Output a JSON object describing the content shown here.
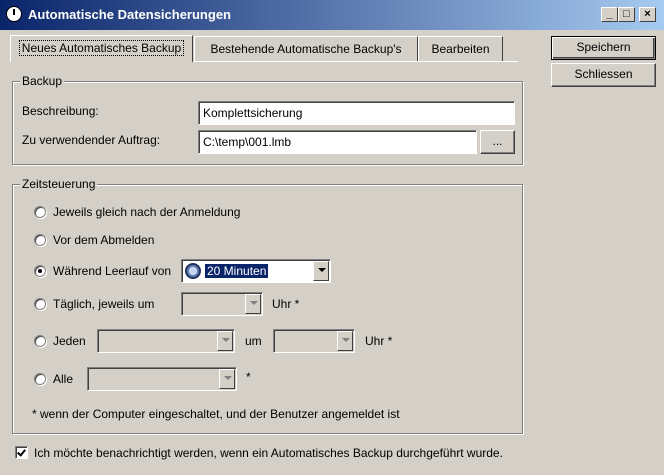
{
  "window": {
    "title": "Automatische Datensicherungen",
    "minimize": "_",
    "maximize": "□",
    "close": "×"
  },
  "tabs": [
    {
      "label": "Neues Automatisches Backup"
    },
    {
      "label": "Bestehende Automatische Backup's"
    },
    {
      "label": "Bearbeiten"
    }
  ],
  "buttons": {
    "save": "Speichern",
    "close": "Schliessen",
    "browse": "..."
  },
  "backup": {
    "legend": "Backup",
    "description_label": "Beschreibung:",
    "description_value": "Komplettsicherung",
    "job_label": "Zu verwendender Auftrag:",
    "job_value": "C:\\temp\\001.lmb"
  },
  "schedule": {
    "legend": "Zeitsteuerung",
    "opt_after_login": "Jeweils gleich nach der Anmeldung",
    "opt_before_logout": "Vor dem Abmelden",
    "opt_idle": "Während Leerlauf von",
    "idle_value": "20 Minuten",
    "opt_daily": "Täglich, jeweils um",
    "uhr_star": "Uhr *",
    "opt_every": "Jeden",
    "um": "um",
    "opt_all": "Alle",
    "star": "*",
    "footnote": "* wenn der Computer eingeschaltet, und der Benutzer angemeldet ist"
  },
  "notify": {
    "label": "Ich möchte benachrichtigt werden, wenn ein Automatisches Backup durchgeführt wurde."
  }
}
